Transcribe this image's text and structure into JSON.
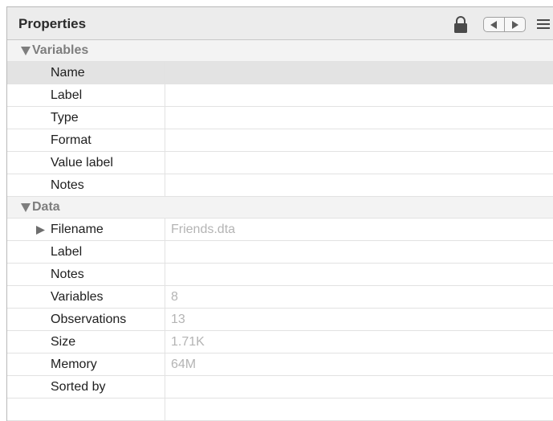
{
  "header": {
    "title": "Properties"
  },
  "icons": {
    "lock": "lock-icon",
    "prev": "arrow-left-icon",
    "next": "arrow-right-icon",
    "menu": "menu-icon"
  },
  "sections": {
    "variables": {
      "title": "Variables",
      "rows": [
        {
          "label": "Name",
          "value": ""
        },
        {
          "label": "Label",
          "value": ""
        },
        {
          "label": "Type",
          "value": ""
        },
        {
          "label": "Format",
          "value": ""
        },
        {
          "label": "Value label",
          "value": ""
        },
        {
          "label": "Notes",
          "value": ""
        }
      ]
    },
    "data": {
      "title": "Data",
      "rows": [
        {
          "label": "Filename",
          "value": "Friends.dta"
        },
        {
          "label": "Label",
          "value": ""
        },
        {
          "label": "Notes",
          "value": ""
        },
        {
          "label": "Variables",
          "value": "8"
        },
        {
          "label": "Observations",
          "value": "13"
        },
        {
          "label": "Size",
          "value": "1.71K"
        },
        {
          "label": "Memory",
          "value": "64M"
        },
        {
          "label": "Sorted by",
          "value": ""
        }
      ]
    }
  },
  "colors": {
    "header_bg": "#ececec",
    "selected_row": "#e3e3e3",
    "value_text": "#b4b4b4",
    "section_text": "#7e7e7e"
  }
}
